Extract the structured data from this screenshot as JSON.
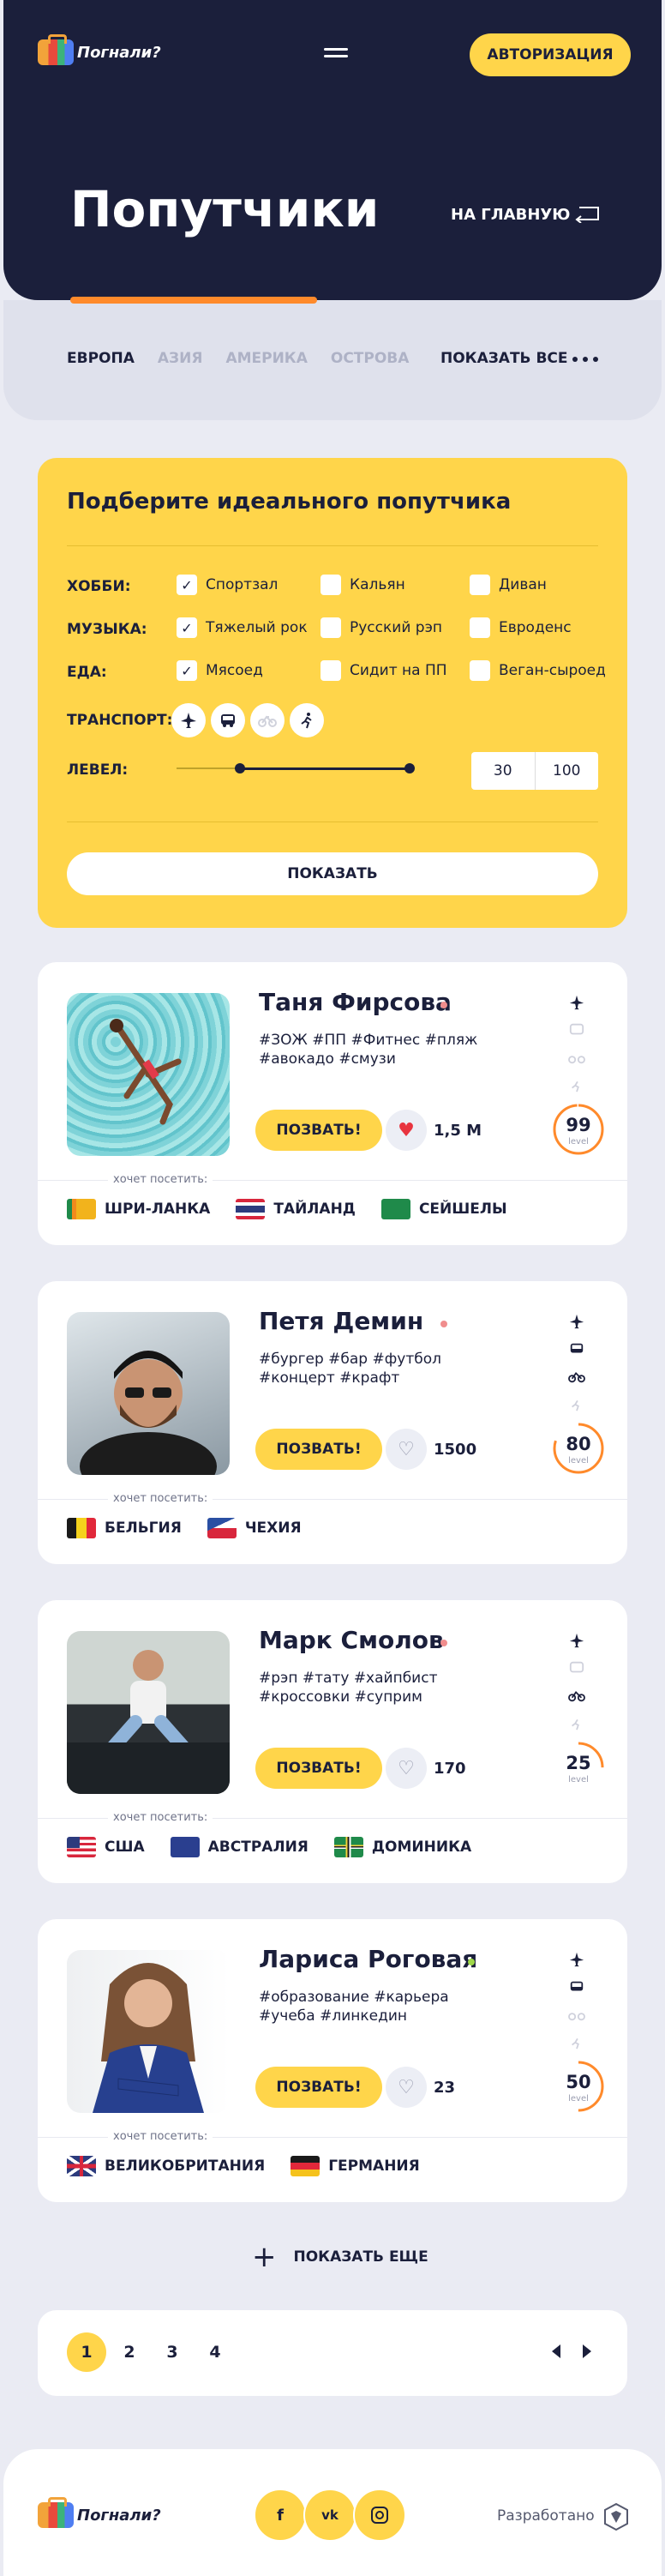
{
  "header": {
    "logo_text": "Погнали?",
    "auth_label": "АВТОРИЗАЦИЯ",
    "title": "Попутчики",
    "home_link": "НА ГЛАВНУЮ"
  },
  "regions": {
    "tabs": [
      "ЕВРОПА",
      "АЗИЯ",
      "АМЕРИКА",
      "ОСТРОВА"
    ],
    "active": "ЕВРОПА",
    "show_all": "ПОКАЗАТЬ ВСЕ"
  },
  "filter": {
    "title": "Подберите идеального попутчика",
    "hobby_label": "ХОББИ:",
    "music_label": "МУЗЫКА:",
    "food_label": "ЕДА:",
    "transport_label": "ТРАНСПОРТ:",
    "level_label": "ЛЕВЕЛ:",
    "hobby": [
      {
        "label": "Спортзал",
        "checked": true
      },
      {
        "label": "Кальян",
        "checked": false
      },
      {
        "label": "Диван",
        "checked": false
      }
    ],
    "music": [
      {
        "label": "Тяжелый рок",
        "checked": true
      },
      {
        "label": "Русский рэп",
        "checked": false
      },
      {
        "label": "Евроденс",
        "checked": false
      }
    ],
    "food": [
      {
        "label": "Мясоед",
        "checked": true
      },
      {
        "label": "Сидит на ПП",
        "checked": false
      },
      {
        "label": "Веган-сыроед",
        "checked": false
      }
    ],
    "level_min": "30",
    "level_max": "100",
    "show_label": "ПОКАЗАТЬ"
  },
  "cards": [
    {
      "name": "Таня Фирсова",
      "tags": "#ЗОЖ #ПП #Фитнес #пляж #авокадо #смузи",
      "go_label": "ПОЗВАТЬ!",
      "likes": "1,5 М",
      "liked": true,
      "level": "99",
      "level_progress": 0.99,
      "wants_label": "хочет посетить:",
      "countries": [
        "ШРИ-ЛАНКА",
        "ТАЙЛАНД",
        "СЕЙШЕЛЫ"
      ]
    },
    {
      "name": "Петя Демин",
      "tags": "#бургер #бар #футбол #концерт #крафт",
      "go_label": "ПОЗВАТЬ!",
      "likes": "1500",
      "liked": false,
      "level": "80",
      "level_progress": 0.8,
      "wants_label": "хочет посетить:",
      "countries": [
        "БЕЛЬГИЯ",
        "ЧЕХИЯ"
      ]
    },
    {
      "name": "Марк Смолов",
      "tags": "#рэп #тату #хайпбист #кроссовки #суприм",
      "go_label": "ПОЗВАТЬ!",
      "likes": "170",
      "liked": false,
      "level": "25",
      "level_progress": 0.25,
      "wants_label": "хочет посетить:",
      "countries": [
        "США",
        "АВСТРАЛИЯ",
        "ДОМИНИКА"
      ]
    },
    {
      "name": "Лариса Роговая",
      "tags": "#образование #карьера #учеба #линкедин",
      "go_label": "ПОЗВАТЬ!",
      "likes": "23",
      "liked": false,
      "level": "50",
      "level_progress": 0.5,
      "wants_label": "хочет посетить:",
      "countries": [
        "ВЕЛИКОБРИТАНИЯ",
        "ГЕРМАНИЯ"
      ]
    }
  ],
  "level_word": "level",
  "more_label": "ПОКАЗАТЬ ЕЩЕ",
  "pagination": {
    "pages": [
      "1",
      "2",
      "3",
      "4"
    ],
    "active": "1"
  },
  "footer": {
    "logo_text": "Погнали?",
    "socials": [
      "f",
      "vk",
      "ig"
    ],
    "developed_by": "Разработано"
  },
  "colors": {
    "navy": "#1b1f3b",
    "yellow": "#ffd54a",
    "orange": "#ff8a2b",
    "like_red": "#e8343f"
  }
}
